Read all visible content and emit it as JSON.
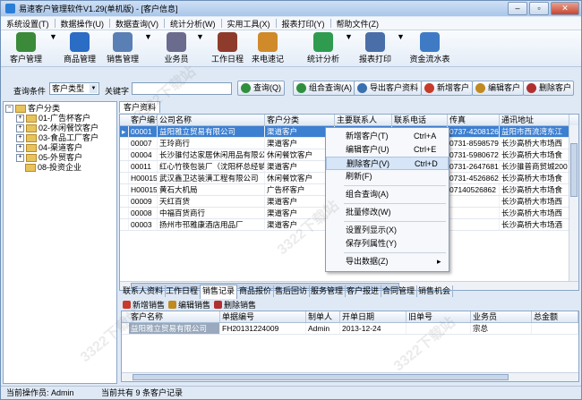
{
  "window": {
    "title": "易速客户管理软件V1.29(单机版) - [客户信息]",
    "buttons": [
      "–",
      "▫",
      "✕"
    ]
  },
  "menu": [
    "系统设置(T)",
    "数据操作(U)",
    "数据查询(V)",
    "统计分析(W)",
    "实用工具(X)",
    "报表打印(Y)",
    "帮助文件(Z)"
  ],
  "toolbar": [
    {
      "label": "客户管理",
      "color": "#3a8a3a"
    },
    {
      "label": "商品管理",
      "color": "#2b6cc4"
    },
    {
      "label": "销售管理",
      "color": "#5a7fb5"
    },
    {
      "label": "业务员",
      "color": "#6b6b8e"
    },
    {
      "label": "工作日程",
      "color": "#8f3b2b"
    },
    {
      "label": "来电速记",
      "color": "#d08a2a"
    },
    {
      "label": "统计分析",
      "color": "#2e9b4f"
    },
    {
      "label": "报表打印",
      "color": "#4a6fa8"
    },
    {
      "label": "资金流水表",
      "color": "#3f7bc4"
    }
  ],
  "search": {
    "condition_label": "查询条件",
    "condition_value": "客户类型",
    "keyword_label": "关键字",
    "buttons": [
      {
        "label": "查询(Q)",
        "color": "#2f8f3d"
      },
      {
        "label": "组合查询(A)",
        "color": "#2f8f3d"
      },
      {
        "label": "导出客户资料",
        "color": "#3a6fb0"
      },
      {
        "label": "新增客户",
        "color": "#c83a2a"
      },
      {
        "label": "编辑客户",
        "color": "#c08a20"
      },
      {
        "label": "删除客户",
        "color": "#b03030"
      }
    ]
  },
  "tree": {
    "root": "客户分类",
    "items": [
      "01-广告杯客户",
      "02-休闲餐饮客户",
      "03-食品工厂客户",
      "04-渠道客户",
      "05-外贸客户",
      "08-投资企业"
    ]
  },
  "grid": {
    "tab": "客户资料",
    "columns": [
      "客户编号",
      "公司名称",
      "客户分类",
      "主要联系人",
      "联系电话",
      "传真",
      "通讯地址"
    ],
    "rows": [
      [
        "00001",
        "益阳雅立贸易有限公司",
        "渠道客户",
        "",
        "",
        "0737-4208126",
        "益阳市西流湾东江"
      ],
      [
        "00007",
        "王玲商行",
        "渠道客户",
        "",
        "",
        "0731-85985792",
        "长沙高桥大市场西"
      ],
      [
        "00004",
        "长沙骓付达家居休闲用品有限公司",
        "休闲餐饮客户",
        "",
        "",
        "0731-5980672",
        "长沙高桥大市场食"
      ],
      [
        "00011",
        "红心竹筷包装厂（沈阳杯总经销）",
        "渠道客户",
        "",
        "",
        "0731-2647681/5",
        "长沙骓普商贸城200"
      ],
      [
        "H000155",
        "武汉鑫卫达装潢工程有限公司",
        "休闲餐饮客户",
        "",
        "",
        "0731-4526862",
        "长沙高桥大市场食"
      ],
      [
        "H000156",
        "黄石大机局",
        "广告杯客户",
        "",
        "",
        "07140526862",
        "长沙高桥大市场食"
      ],
      [
        "00009",
        "天红百货",
        "渠道客户",
        "",
        "",
        "",
        "长沙高桥大市场西"
      ],
      [
        "00008",
        "中福百货商行",
        "渠道客户",
        "",
        "",
        "",
        "长沙高桥大市场西"
      ],
      [
        "00003",
        "扬州市邗雅康酒店用品厂",
        "渠道客户",
        "",
        "",
        "",
        "长沙高桥大市场酒"
      ]
    ]
  },
  "context_menu": [
    {
      "label": "新增客户(T)",
      "key": "Ctrl+A"
    },
    {
      "label": "编辑客户(U)",
      "key": "Ctrl+E"
    },
    {
      "label": "删除客户(V)",
      "key": "Ctrl+D"
    },
    {
      "label": "刷新(F)",
      "key": ""
    },
    {
      "label": "组合查询(A)",
      "key": ""
    },
    {
      "label": "批量修改(W)",
      "key": ""
    },
    {
      "label": "设置列显示(X)",
      "key": ""
    },
    {
      "label": "保存列属性(Y)",
      "key": ""
    },
    {
      "label": "导出数据(Z)",
      "key": "▸"
    }
  ],
  "bottom_tabs": [
    "联系人资料",
    "工作日程",
    "销售记录",
    "商品报价",
    "售后回访",
    "服务管理",
    "客户报进",
    "合同管理",
    "销售机会"
  ],
  "sub_toolbar": [
    "新增销售",
    "编辑销售",
    "删除销售"
  ],
  "sales_grid": {
    "columns": [
      "客户名称",
      "单据编号",
      "制单人",
      "开单日期",
      "旧单号",
      "业务员",
      "总金额"
    ],
    "rows": [
      [
        "益阳雅立贸易有限公司",
        "FH20131224009",
        "Admin",
        "2013-12-24",
        "",
        "宗总",
        ""
      ]
    ]
  },
  "status": {
    "operator": "当前操作员: Admin",
    "count": "当前共有 9 条客户记录"
  },
  "watermark": "3322下载站"
}
